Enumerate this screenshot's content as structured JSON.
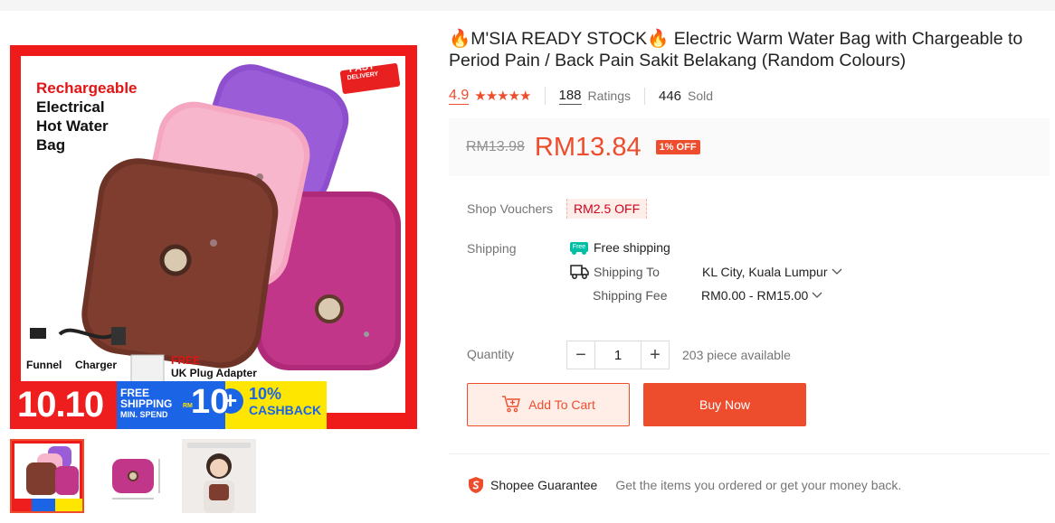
{
  "product": {
    "title_fire_left": "🔥",
    "title_prefix": "M'SIA READY STOCK",
    "title_fire_right": "🔥",
    "title_rest": " Electric Warm Water Bag with Chargeable to Period Pain / Back Pain Sakit Belakang (Random Colours)"
  },
  "stats": {
    "rating": "4.9",
    "stars": "★★★★★",
    "ratings_count": "188",
    "ratings_label": "Ratings",
    "sold_count": "446",
    "sold_label": "Sold"
  },
  "price": {
    "original": "RM13.98",
    "current": "RM13.84",
    "discount": "1% OFF"
  },
  "vouchers": {
    "label": "Shop Vouchers",
    "value": "RM2.5 OFF"
  },
  "shipping": {
    "label": "Shipping",
    "free_tag": "Free",
    "free_text": "Free shipping",
    "to_label": "Shipping To",
    "to_value": "KL City, Kuala Lumpur",
    "fee_label": "Shipping Fee",
    "fee_value": "RM0.00 - RM15.00"
  },
  "quantity": {
    "label": "Quantity",
    "minus": "−",
    "value": "1",
    "plus": "+",
    "available": "203 piece available"
  },
  "actions": {
    "add_to_cart": "Add To Cart",
    "buy_now": "Buy Now"
  },
  "guarantee": {
    "title": "Shopee Guarantee",
    "text": "Get the items you ordered or get your money back."
  },
  "banner": {
    "headline_1": "Rechargeable",
    "headline_2": "Electrical",
    "headline_3": "Hot Water",
    "headline_4": "Bag",
    "fast_1": "FAST",
    "fast_2": "DELIVERY",
    "funnel": "Funnel",
    "charger": "Charger",
    "free": "FREE",
    "uk_plug": "UK Plug Adapter",
    "sale_date": "10.10",
    "free_shipping_1": "FREE",
    "free_shipping_2": "SHIPPING",
    "min_spend": "MIN. SPEND",
    "rm": "RM",
    "ten": "10",
    "plus": "+",
    "cashback_pct": "10%",
    "cashback": "CASHBACK"
  },
  "colors": {
    "accent": "#ee4d2d",
    "teal": "#00bfa5",
    "banner_red": "#f01818",
    "banner_blue": "#1b64e6",
    "banner_yellow": "#ffe600"
  }
}
